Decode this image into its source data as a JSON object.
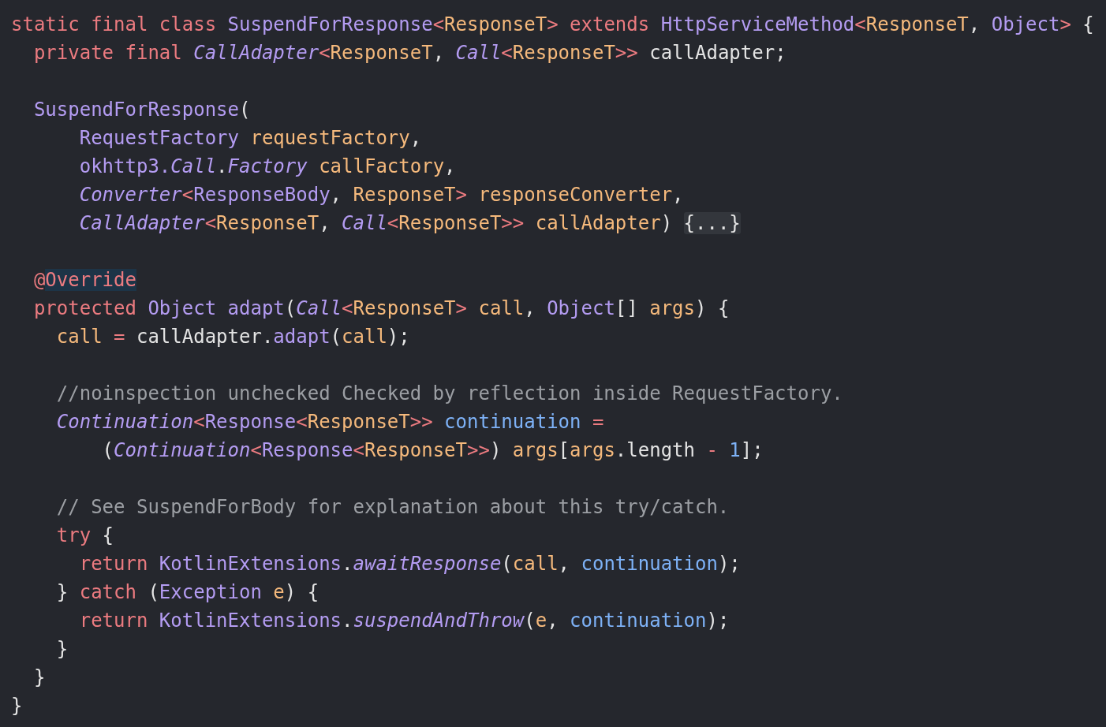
{
  "editor": {
    "lines": [
      {
        "kind": "code",
        "tokens": [
          {
            "kind": "kw",
            "text": "static final class "
          },
          {
            "kind": "type",
            "text": "SuspendForResponse"
          },
          {
            "kind": "kw",
            "text": "<"
          },
          {
            "kind": "var",
            "text": "ResponseT"
          },
          {
            "kind": "kw",
            "text": ">"
          },
          {
            "kind": "kw",
            "text": " extends "
          },
          {
            "kind": "type",
            "text": "HttpServiceMethod"
          },
          {
            "kind": "kw",
            "text": "<"
          },
          {
            "kind": "var",
            "text": "ResponseT"
          },
          {
            "kind": "plain",
            "text": ", "
          },
          {
            "kind": "type",
            "text": "Object"
          },
          {
            "kind": "kw",
            "text": ">"
          },
          {
            "kind": "plain",
            "text": " {"
          }
        ]
      },
      {
        "kind": "code",
        "tokens": [
          {
            "kind": "kw",
            "text": "  private final "
          },
          {
            "kind": "itype",
            "text": "CallAdapter"
          },
          {
            "kind": "kw",
            "text": "<"
          },
          {
            "kind": "var",
            "text": "ResponseT"
          },
          {
            "kind": "plain",
            "text": ", "
          },
          {
            "kind": "itype",
            "text": "Call"
          },
          {
            "kind": "kw",
            "text": "<"
          },
          {
            "kind": "var",
            "text": "ResponseT"
          },
          {
            "kind": "kw",
            "text": ">>"
          },
          {
            "kind": "plain",
            "text": " callAdapter;"
          }
        ]
      },
      {
        "kind": "blank"
      },
      {
        "kind": "code",
        "tokens": [
          {
            "kind": "type",
            "text": "  SuspendForResponse"
          },
          {
            "kind": "plain",
            "text": "("
          }
        ]
      },
      {
        "kind": "code",
        "tokens": [
          {
            "kind": "type",
            "text": "      RequestFactory"
          },
          {
            "kind": "var",
            "text": " requestFactory"
          },
          {
            "kind": "plain",
            "text": ","
          }
        ]
      },
      {
        "kind": "code",
        "tokens": [
          {
            "kind": "type",
            "text": "      okhttp3."
          },
          {
            "kind": "itype",
            "text": "Call"
          },
          {
            "kind": "plain",
            "text": "."
          },
          {
            "kind": "itype",
            "text": "Factory"
          },
          {
            "kind": "var",
            "text": " callFactory"
          },
          {
            "kind": "plain",
            "text": ","
          }
        ]
      },
      {
        "kind": "code",
        "tokens": [
          {
            "kind": "itype",
            "text": "      Converter"
          },
          {
            "kind": "kw",
            "text": "<"
          },
          {
            "kind": "type",
            "text": "ResponseBody"
          },
          {
            "kind": "plain",
            "text": ", "
          },
          {
            "kind": "var",
            "text": "ResponseT"
          },
          {
            "kind": "kw",
            "text": ">"
          },
          {
            "kind": "var",
            "text": " responseConverter"
          },
          {
            "kind": "plain",
            "text": ","
          }
        ]
      },
      {
        "kind": "code",
        "tokens": [
          {
            "kind": "itype",
            "text": "      CallAdapter"
          },
          {
            "kind": "kw",
            "text": "<"
          },
          {
            "kind": "var",
            "text": "ResponseT"
          },
          {
            "kind": "plain",
            "text": ", "
          },
          {
            "kind": "itype",
            "text": "Call"
          },
          {
            "kind": "kw",
            "text": "<"
          },
          {
            "kind": "var",
            "text": "ResponseT"
          },
          {
            "kind": "kw",
            "text": ">>"
          },
          {
            "kind": "var",
            "text": " callAdapter"
          },
          {
            "kind": "plain",
            "text": ") "
          },
          {
            "kind": "fold",
            "text": "{...}"
          }
        ]
      },
      {
        "kind": "blank"
      },
      {
        "kind": "code",
        "tokens": [
          {
            "kind": "ann",
            "text": "  @Override"
          }
        ]
      },
      {
        "kind": "code",
        "tokens": [
          {
            "kind": "kw",
            "text": "  protected "
          },
          {
            "kind": "type",
            "text": "Object adapt"
          },
          {
            "kind": "plain",
            "text": "("
          },
          {
            "kind": "itype",
            "text": "Call"
          },
          {
            "kind": "kw",
            "text": "<"
          },
          {
            "kind": "var",
            "text": "ResponseT"
          },
          {
            "kind": "kw",
            "text": ">"
          },
          {
            "kind": "var",
            "text": " call"
          },
          {
            "kind": "plain",
            "text": ", "
          },
          {
            "kind": "type",
            "text": "Object"
          },
          {
            "kind": "plain",
            "text": "[] "
          },
          {
            "kind": "var",
            "text": "args"
          },
          {
            "kind": "plain",
            "text": ") {"
          }
        ]
      },
      {
        "kind": "code",
        "tokens": [
          {
            "kind": "var",
            "text": "    call"
          },
          {
            "kind": "kw",
            "text": " = "
          },
          {
            "kind": "plain",
            "text": "callAdapter."
          },
          {
            "kind": "type",
            "text": "adapt"
          },
          {
            "kind": "plain",
            "text": "("
          },
          {
            "kind": "var",
            "text": "call"
          },
          {
            "kind": "plain",
            "text": ");"
          }
        ]
      },
      {
        "kind": "blank"
      },
      {
        "kind": "code",
        "tokens": [
          {
            "kind": "comment",
            "text": "    //noinspection unchecked Checked by reflection inside RequestFactory."
          }
        ]
      },
      {
        "kind": "code",
        "tokens": [
          {
            "kind": "itype",
            "text": "    Continuation"
          },
          {
            "kind": "kw",
            "text": "<"
          },
          {
            "kind": "type",
            "text": "Response"
          },
          {
            "kind": "kw",
            "text": "<"
          },
          {
            "kind": "var",
            "text": "ResponseT"
          },
          {
            "kind": "kw",
            "text": ">>"
          },
          {
            "kind": "field",
            "text": " continuation"
          },
          {
            "kind": "kw",
            "text": " ="
          }
        ]
      },
      {
        "kind": "code",
        "tokens": [
          {
            "kind": "plain",
            "text": "        ("
          },
          {
            "kind": "itype",
            "text": "Continuation"
          },
          {
            "kind": "kw",
            "text": "<"
          },
          {
            "kind": "type",
            "text": "Response"
          },
          {
            "kind": "kw",
            "text": "<"
          },
          {
            "kind": "var",
            "text": "ResponseT"
          },
          {
            "kind": "kw",
            "text": ">>"
          },
          {
            "kind": "plain",
            "text": ") "
          },
          {
            "kind": "var",
            "text": "args"
          },
          {
            "kind": "plain",
            "text": "["
          },
          {
            "kind": "var",
            "text": "args"
          },
          {
            "kind": "plain",
            "text": ".length "
          },
          {
            "kind": "kw",
            "text": "- "
          },
          {
            "kind": "num",
            "text": "1"
          },
          {
            "kind": "plain",
            "text": "];"
          }
        ]
      },
      {
        "kind": "blank"
      },
      {
        "kind": "code",
        "tokens": [
          {
            "kind": "comment",
            "text": "    // See SuspendForBody for explanation about this try/catch."
          }
        ]
      },
      {
        "kind": "code",
        "tokens": [
          {
            "kind": "kw",
            "text": "    try"
          },
          {
            "kind": "plain",
            "text": " {"
          }
        ]
      },
      {
        "kind": "code",
        "tokens": [
          {
            "kind": "kw",
            "text": "      return "
          },
          {
            "kind": "type",
            "text": "KotlinExtensions"
          },
          {
            "kind": "plain",
            "text": "."
          },
          {
            "kind": "itype",
            "text": "awaitResponse"
          },
          {
            "kind": "plain",
            "text": "("
          },
          {
            "kind": "var",
            "text": "call"
          },
          {
            "kind": "plain",
            "text": ", "
          },
          {
            "kind": "field",
            "text": "continuation"
          },
          {
            "kind": "plain",
            "text": ");"
          }
        ]
      },
      {
        "kind": "code",
        "tokens": [
          {
            "kind": "plain",
            "text": "    } "
          },
          {
            "kind": "kw",
            "text": "catch"
          },
          {
            "kind": "plain",
            "text": " ("
          },
          {
            "kind": "type",
            "text": "Exception"
          },
          {
            "kind": "var",
            "text": " e"
          },
          {
            "kind": "plain",
            "text": ") {"
          }
        ]
      },
      {
        "kind": "code",
        "tokens": [
          {
            "kind": "kw",
            "text": "      return "
          },
          {
            "kind": "type",
            "text": "KotlinExtensions"
          },
          {
            "kind": "plain",
            "text": "."
          },
          {
            "kind": "itype",
            "text": "suspendAndThrow"
          },
          {
            "kind": "plain",
            "text": "("
          },
          {
            "kind": "var",
            "text": "e"
          },
          {
            "kind": "plain",
            "text": ", "
          },
          {
            "kind": "field",
            "text": "continuation"
          },
          {
            "kind": "plain",
            "text": ");"
          }
        ]
      },
      {
        "kind": "code",
        "tokens": [
          {
            "kind": "plain",
            "text": "    }"
          }
        ]
      },
      {
        "kind": "code",
        "tokens": [
          {
            "kind": "plain",
            "text": "  }"
          }
        ]
      },
      {
        "kind": "code",
        "tokens": [
          {
            "kind": "plain",
            "text": "}"
          }
        ]
      }
    ]
  }
}
